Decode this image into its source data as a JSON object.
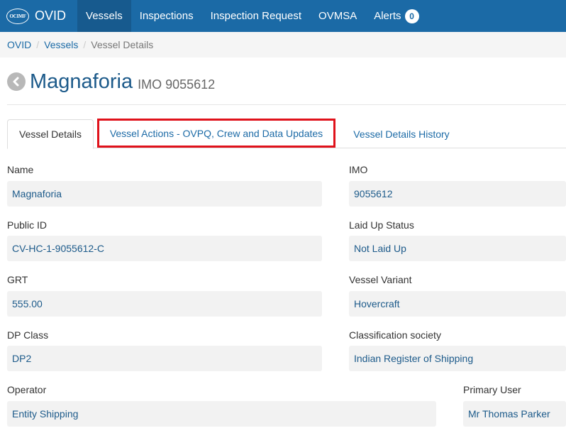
{
  "navbar": {
    "logo_text": "OCIMF",
    "brand": "OVID",
    "items": [
      {
        "label": "Vessels",
        "active": true
      },
      {
        "label": "Inspections"
      },
      {
        "label": "Inspection Request"
      },
      {
        "label": "OVMSA"
      },
      {
        "label": "Alerts",
        "badge": "0"
      }
    ]
  },
  "breadcrumb": {
    "items": [
      "OVID",
      "Vessels",
      "Vessel Details"
    ],
    "separator": "/"
  },
  "header": {
    "vessel_name": "Magnaforia",
    "imo_label": "IMO 9055612"
  },
  "tabs": [
    {
      "label": "Vessel Details",
      "active": true
    },
    {
      "label": "Vessel Actions - OVPQ, Crew and Data Updates",
      "highlighted": true
    },
    {
      "label": "Vessel Details History"
    }
  ],
  "fields": {
    "name": {
      "label": "Name",
      "value": "Magnaforia"
    },
    "imo": {
      "label": "IMO",
      "value": "9055612"
    },
    "public_id": {
      "label": "Public ID",
      "value": "CV-HC-1-9055612-C"
    },
    "laid_up_status": {
      "label": "Laid Up Status",
      "value": "Not Laid Up"
    },
    "grt": {
      "label": "GRT",
      "value": "555.00"
    },
    "vessel_variant": {
      "label": "Vessel Variant",
      "value": "Hovercraft"
    },
    "dp_class": {
      "label": "DP Class",
      "value": "DP2"
    },
    "classification_society": {
      "label": "Classification society",
      "value": "Indian Register of Shipping"
    },
    "operator": {
      "label": "Operator",
      "value": "Entity Shipping"
    },
    "primary_user": {
      "label": "Primary User",
      "value": "Mr Thomas Parker"
    }
  },
  "colors": {
    "navbar": "#1b6aa6",
    "navbar_active": "#175a8e",
    "link": "#1b6aa6",
    "highlight": "#e0121b",
    "field_background": "#f2f2f2"
  }
}
